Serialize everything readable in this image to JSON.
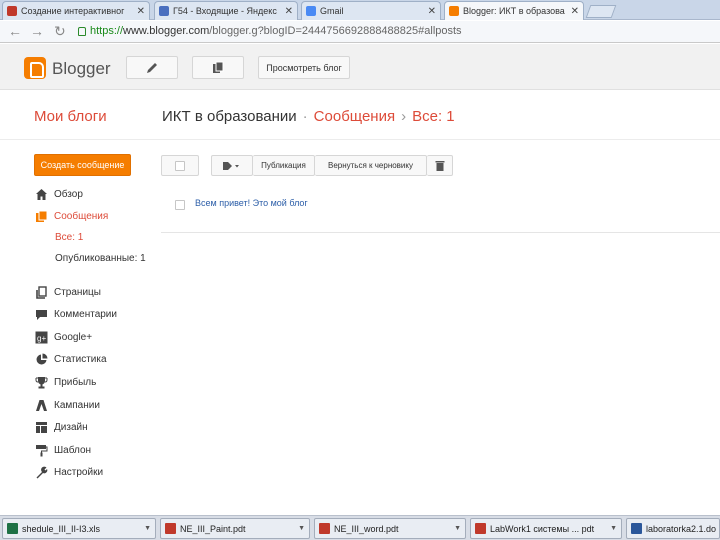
{
  "browser": {
    "tabs": [
      {
        "label": "Создание интерактивног",
        "favicon_color": "#c0392b"
      },
      {
        "label": "Г54 - Входящие - Яндекс",
        "favicon_color": "#4a6fbf"
      },
      {
        "label": "Gmail",
        "favicon_color": "#4a8af4"
      },
      {
        "label": "Blogger: ИКТ в образова",
        "favicon_color": "#f57d00"
      }
    ],
    "close_glyph": "✕",
    "back_glyph": "←",
    "forward_glyph": "→",
    "reload_glyph": "↻",
    "url": {
      "scheme": "https://",
      "host": "www.blogger.com",
      "path": "/blogger.g?blogID=2444756692888488825#allposts"
    }
  },
  "header": {
    "logo_text": "Blogger",
    "view_blog_label": "Просмотреть блог",
    "accent_color": "#f57d00"
  },
  "titlebar": {
    "my_blogs": "Мои блоги",
    "blog_name": "ИКТ в образовании",
    "separator": "·",
    "section": "Сообщения",
    "arrow": "›",
    "filter": "Все: 1"
  },
  "sidebar": {
    "new_post_label": "Создать сообщение",
    "items": [
      {
        "label": "Обзор",
        "icon": "home-icon"
      },
      {
        "label": "Сообщения",
        "icon": "posts-icon",
        "selected": true
      },
      {
        "label": "Страницы",
        "icon": "pages-icon"
      },
      {
        "label": "Комментарии",
        "icon": "comments-icon"
      },
      {
        "label": "Google+",
        "icon": "google-plus-icon"
      },
      {
        "label": "Статистика",
        "icon": "stats-icon"
      },
      {
        "label": "Прибыль",
        "icon": "trophy-icon"
      },
      {
        "label": "Кампании",
        "icon": "campaigns-icon"
      },
      {
        "label": "Дизайн",
        "icon": "layout-icon"
      },
      {
        "label": "Шаблон",
        "icon": "template-icon"
      },
      {
        "label": "Настройки",
        "icon": "settings-icon"
      }
    ],
    "sub_items": [
      {
        "label": "Все: 1",
        "selected": true
      },
      {
        "label": "Опубликованные: 1",
        "selected": false
      }
    ]
  },
  "toolbar": {
    "publish_label": "Публикация",
    "revert_label": "Вернуться к черновику"
  },
  "posts": [
    {
      "title": "Всем привет! Это мой блог"
    }
  ],
  "taskbar": {
    "items": [
      {
        "label": "shedule_III_II-I3.xls",
        "icon_color": "#1e7145"
      },
      {
        "label": "NE_III_Paint.pdt",
        "icon_color": "#c0392b"
      },
      {
        "label": "NE_III_word.pdt",
        "icon_color": "#c0392b"
      },
      {
        "label": "LabWork1 системы ... pdt",
        "icon_color": "#c0392b"
      },
      {
        "label": "laboratorka2.1.do",
        "icon_color": "#2b579a"
      }
    ]
  }
}
